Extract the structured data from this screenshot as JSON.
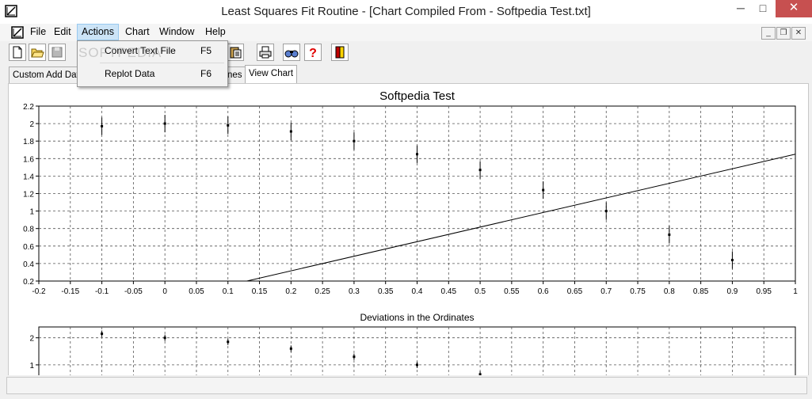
{
  "window": {
    "title": "Least Squares Fit Routine - [Chart Compiled From - Softpedia Test.txt]"
  },
  "title_controls": {
    "minimize": "─",
    "maximize": "□",
    "close": "✕"
  },
  "menu": [
    "File",
    "Edit",
    "Actions",
    "Chart",
    "Window",
    "Help"
  ],
  "menu_active": "Actions",
  "mdi_controls": {
    "minimize": "_",
    "restore": "❐",
    "close": "✕"
  },
  "actions_menu": [
    {
      "label": "Convert Text File",
      "shortcut": "F5"
    },
    {
      "label": "Replot Data",
      "shortcut": "F6"
    }
  ],
  "toolbar_icons": [
    "new-file-icon",
    "open-folder-icon",
    "save-icon",
    "paste-icon",
    "print-icon",
    "binoculars-icon",
    "help-icon",
    "exit-door-icon"
  ],
  "tabs": [
    "Custom Add Data",
    "nes",
    "View Chart"
  ],
  "selected_tab": "View Chart",
  "watermark": "SOFTPEDIA",
  "chart_data": [
    {
      "type": "scatter",
      "title": "Softpedia Test",
      "xlim": [
        -0.2,
        1
      ],
      "ylim": [
        0.2,
        2.2
      ],
      "x_ticks": [
        "-0.2",
        "-0.15",
        "-0.1",
        "-0.05",
        "0",
        "0.05",
        "0.1",
        "0.15",
        "0.2",
        "0.25",
        "0.3",
        "0.35",
        "0.4",
        "0.45",
        "0.5",
        "0.55",
        "0.6",
        "0.65",
        "0.7",
        "0.75",
        "0.8",
        "0.85",
        "0.9",
        "0.95",
        "1"
      ],
      "y_ticks": [
        "0.2",
        "0.4",
        "0.6",
        "0.8",
        "1",
        "1.2",
        "1.4",
        "1.6",
        "1.8",
        "2",
        "2.2"
      ],
      "grid": true,
      "points": [
        {
          "x": -0.1,
          "y": 1.97,
          "err": 0.1
        },
        {
          "x": 0.0,
          "y": 2.0,
          "err": 0.1
        },
        {
          "x": 0.1,
          "y": 1.98,
          "err": 0.1
        },
        {
          "x": 0.2,
          "y": 1.91,
          "err": 0.1
        },
        {
          "x": 0.3,
          "y": 1.8,
          "err": 0.1
        },
        {
          "x": 0.4,
          "y": 1.65,
          "err": 0.1
        },
        {
          "x": 0.5,
          "y": 1.47,
          "err": 0.1
        },
        {
          "x": 0.6,
          "y": 1.24,
          "err": 0.1
        },
        {
          "x": 0.7,
          "y": 1.0,
          "err": 0.1
        },
        {
          "x": 0.8,
          "y": 0.73,
          "err": 0.1
        },
        {
          "x": 0.9,
          "y": 0.44,
          "err": 0.1
        }
      ],
      "fit_line": [
        {
          "x": 0.13,
          "y": 0.2
        },
        {
          "x": 1.0,
          "y": 1.65
        }
      ]
    },
    {
      "type": "scatter",
      "title": "Deviations in the Ordinates",
      "xlim": [
        -0.2,
        1
      ],
      "ylim": [
        0.5,
        2.4
      ],
      "y_ticks": [
        "1",
        "2"
      ],
      "grid": true,
      "points": [
        {
          "x": -0.1,
          "y": 2.15
        },
        {
          "x": 0.0,
          "y": 2.0
        },
        {
          "x": 0.1,
          "y": 1.85
        },
        {
          "x": 0.2,
          "y": 1.6
        },
        {
          "x": 0.3,
          "y": 1.3
        },
        {
          "x": 0.4,
          "y": 1.0
        },
        {
          "x": 0.5,
          "y": 0.65
        }
      ]
    }
  ]
}
